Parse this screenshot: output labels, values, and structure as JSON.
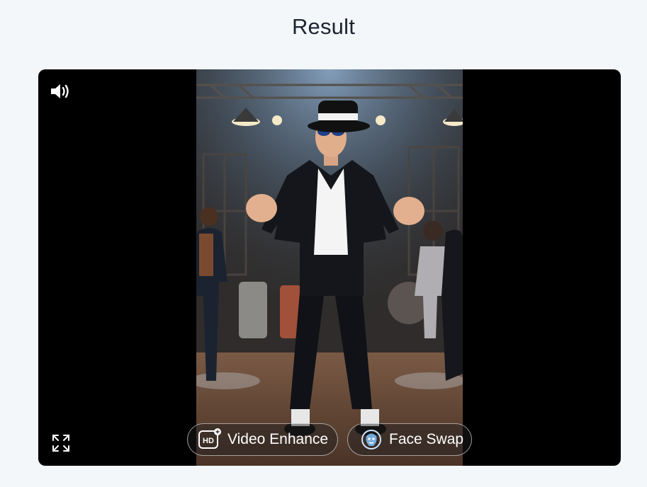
{
  "header": {
    "title": "Result"
  },
  "player": {
    "buttons": {
      "video_enhance": "Video Enhance",
      "face_swap": "Face Swap"
    },
    "icons": {
      "sound": "volume-icon",
      "fullscreen": "fullscreen-icon",
      "enhance": "hd-icon",
      "face_swap": "face-swap-icon"
    }
  },
  "colors": {
    "background": "#f3f7fa",
    "player_bg": "#000000",
    "title": "#1d2430",
    "pill_text": "#ffffff"
  }
}
